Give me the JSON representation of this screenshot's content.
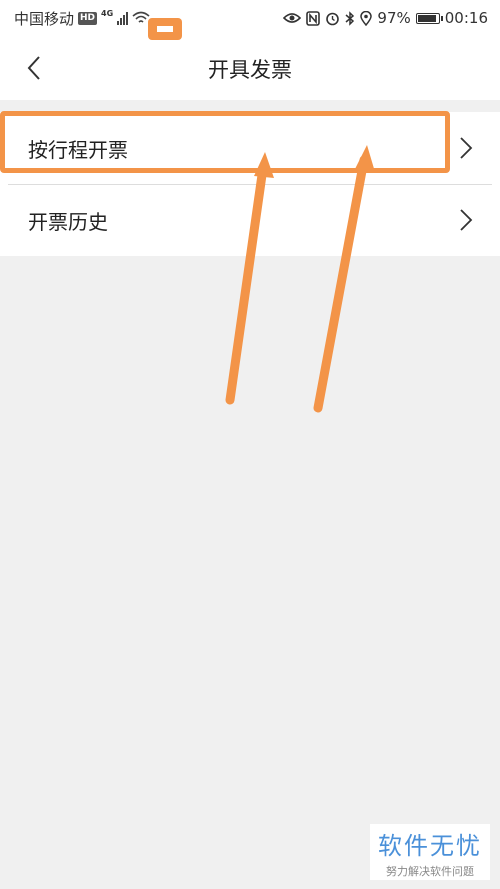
{
  "status_bar": {
    "carrier": "中国移动",
    "hd_badge": "HD",
    "network": "4G",
    "battery_percent": "97%",
    "battery_level": 0.97,
    "time": "00:16",
    "icons": [
      "eye-icon",
      "nfc-icon",
      "alarm-icon",
      "bluetooth-icon",
      "location-icon",
      "battery-icon",
      "wifi-icon",
      "signal-icon"
    ]
  },
  "header": {
    "title": "开具发票",
    "back_icon": "chevron-left-icon"
  },
  "menu": {
    "items": [
      {
        "label": "按行程开票",
        "icon": "chevron-right-icon"
      },
      {
        "label": "开票历史",
        "icon": "chevron-right-icon"
      }
    ]
  },
  "watermark": {
    "title": "软件无忧",
    "subtitle": "努力解决软件问题"
  },
  "colors": {
    "annotation": "#f39448",
    "background": "#f0f0f0",
    "surface": "#ffffff",
    "watermark": "#4a90d9"
  }
}
